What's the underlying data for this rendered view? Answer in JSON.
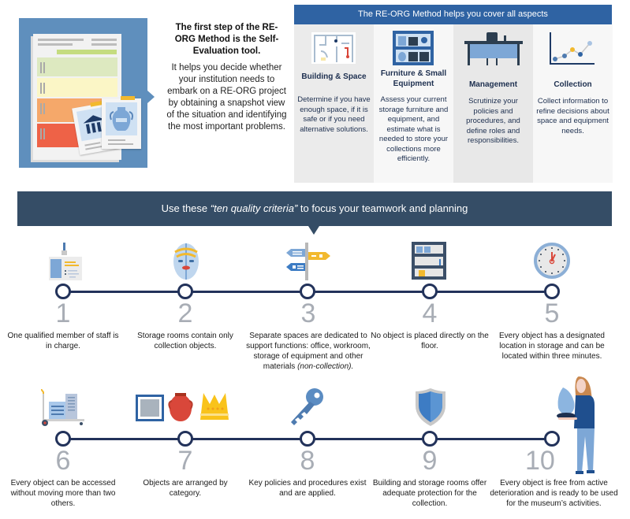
{
  "intro": {
    "heading": "The first step of the RE-ORG Method is the Self-Evaluation tool.",
    "body": "It helps you decide whether your institution needs to embark on a RE-ORG project by obtaining a snapshot view of the situation and identifying the most important problems."
  },
  "aspects": {
    "banner": "The RE-ORG Method helps you cover all aspects",
    "items": [
      {
        "icon": "floor-plan-icon",
        "title": "Building & Space",
        "desc": "Determine if you have enough space, if it is safe or if you need alternative solutions."
      },
      {
        "icon": "shelving-unit-icon",
        "title": "Furniture & Small Equipment",
        "desc": "Assess your current storage furniture and equipment, and estimate what is needed to store your collections more efficiently."
      },
      {
        "icon": "desk-icon",
        "title": "Management",
        "desc": "Scrutinize your policies and procedures, and define roles and responsibilities."
      },
      {
        "icon": "line-graph-icon",
        "title": "Collection",
        "desc": "Collect information to refine decisions about space and equipment needs."
      }
    ]
  },
  "criteria_banner": {
    "before": "Use these ",
    "emphasis": "“ten quality criteria”",
    "after": " to focus your teamwork and planning"
  },
  "criteria": [
    {
      "num": "1",
      "icon": "id-badge-icon",
      "desc": "One qualified member of staff is in charge."
    },
    {
      "num": "2",
      "icon": "mask-icon",
      "desc": "Storage rooms contain only collection objects."
    },
    {
      "num": "3",
      "icon": "signpost-icon",
      "desc": "Separate spaces are dedicated to support functions: office, workroom, storage of equipment and other materials",
      "desc_italic": "(non-collection)."
    },
    {
      "num": "4",
      "icon": "storage-shelf-icon",
      "desc": "No object is placed directly on the floor."
    },
    {
      "num": "5",
      "icon": "clock-icon",
      "desc": "Every object has a designated location in storage and can be located within three minutes."
    },
    {
      "num": "6",
      "icon": "hand-truck-icon",
      "desc": "Every object can be accessed without moving more than two others."
    },
    {
      "num": "7",
      "icon": "frame-vase-crown-icon",
      "desc": "Objects are arranged by category."
    },
    {
      "num": "8",
      "icon": "key-icon",
      "desc": "Key policies and procedures exist and are applied."
    },
    {
      "num": "9",
      "icon": "shield-icon",
      "desc": "Building and storage rooms offer adequate protection for the collection."
    },
    {
      "num": "10",
      "icon": "person-holding-object-icon",
      "desc": "Every object is free from active deterioration and is ready to be used for the museum’s activities."
    }
  ],
  "colors": {
    "aspects_banner": "#2f63a3",
    "criteria_banner": "#354d66",
    "timeline": "#22325a",
    "number_gray": "#a8adb5"
  }
}
